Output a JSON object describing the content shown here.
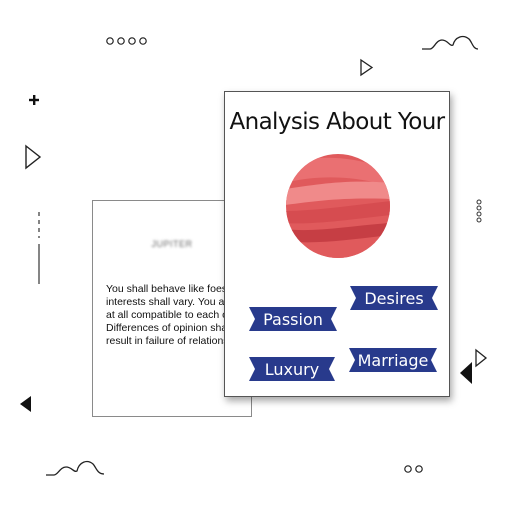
{
  "front_card": {
    "title": "Analysis About Your",
    "ribbons": [
      "Passion",
      "Desires",
      "Luxury",
      "Marriage"
    ]
  },
  "back_card": {
    "title": "JUPITER",
    "text": "You shall behave like foes. interests shall vary. You are not at all compatible to each other. Differences of opinion shall result in failure of relationship."
  },
  "colors": {
    "ribbon": "#283a8c",
    "planet": "#e05a5c",
    "planet_light": "#f08a8a",
    "planet_dark": "#c63e44"
  },
  "icons": [
    "dots-icon",
    "wave-icon",
    "plus-icon",
    "triangle-icon",
    "line-icon"
  ]
}
